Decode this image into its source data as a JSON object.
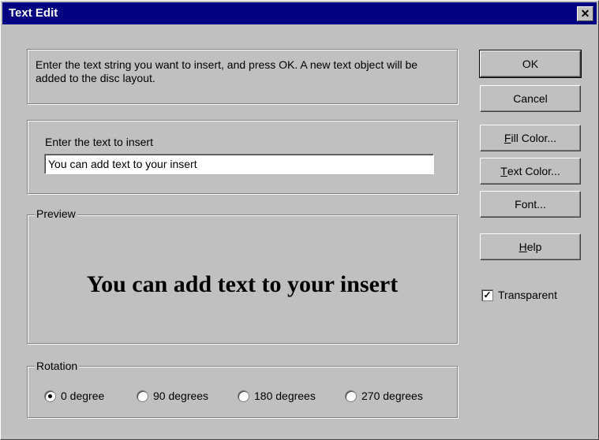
{
  "window": {
    "title": "Text Edit",
    "close_glyph": "✕"
  },
  "instructions": "Enter the text string you want to insert, and press OK.  A new text object will be added to the disc layout.",
  "text_group": {
    "label": "Enter the text to insert",
    "value": "You can add text to your insert"
  },
  "preview": {
    "legend": "Preview",
    "text": "You can add text to your insert"
  },
  "rotation": {
    "legend": "Rotation",
    "options": [
      "0 degree",
      "90 degrees",
      "180 degrees",
      "270 degrees"
    ],
    "selected": "0 degree"
  },
  "buttons": {
    "ok": "OK",
    "cancel": "Cancel",
    "fill_color": {
      "accel": "F",
      "rest": "ill Color..."
    },
    "text_color": {
      "accel": "T",
      "rest": "ext Color..."
    },
    "font": "Font...",
    "help": {
      "accel": "H",
      "rest": "elp"
    }
  },
  "transparent": {
    "label": "Transparent",
    "checked": true
  },
  "colors": {
    "titlebar": "#000080",
    "face": "#c0c0c0"
  }
}
